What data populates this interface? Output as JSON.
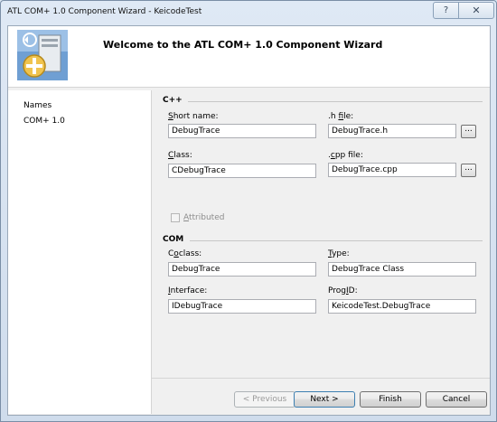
{
  "window": {
    "title": "ATL COM+ 1.0 Component Wizard - KeicodeTest",
    "help_glyph": "?",
    "close_glyph": "✕"
  },
  "banner": {
    "title": "Welcome to the ATL COM+ 1.0 Component Wizard"
  },
  "nav": {
    "items": [
      {
        "label": "Names"
      },
      {
        "label": "COM+ 1.0"
      }
    ]
  },
  "cpp": {
    "group_label": "C++",
    "short_name": {
      "pre": "",
      "key": "S",
      "post": "hort name:",
      "value": "DebugTrace"
    },
    "h_file": {
      "pre": ".h ",
      "key": "f",
      "post": "ile:",
      "value": "DebugTrace.h"
    },
    "class": {
      "pre": "",
      "key": "C",
      "post": "lass:",
      "value": "CDebugTrace"
    },
    "cpp_file": {
      "pre": ".",
      "key": "c",
      "post": "pp file:",
      "value": "DebugTrace.cpp"
    },
    "browse_label": "...",
    "attributed": {
      "pre": "",
      "key": "A",
      "post": "ttributed",
      "checked": false
    }
  },
  "com": {
    "group_label": "COM",
    "coclass": {
      "pre": "C",
      "key": "o",
      "post": "class:",
      "value": "DebugTrace"
    },
    "type": {
      "pre": "",
      "key": "T",
      "post": "ype:",
      "value": "DebugTrace Class"
    },
    "interface": {
      "pre": "",
      "key": "I",
      "post": "nterface:",
      "value": "IDebugTrace"
    },
    "progid": {
      "pre": "Prog",
      "key": "I",
      "post": "D:",
      "value": "KeicodeTest.DebugTrace"
    }
  },
  "buttons": {
    "previous": "< Previous",
    "next": "Next >",
    "finish": "Finish",
    "cancel": "Cancel"
  }
}
